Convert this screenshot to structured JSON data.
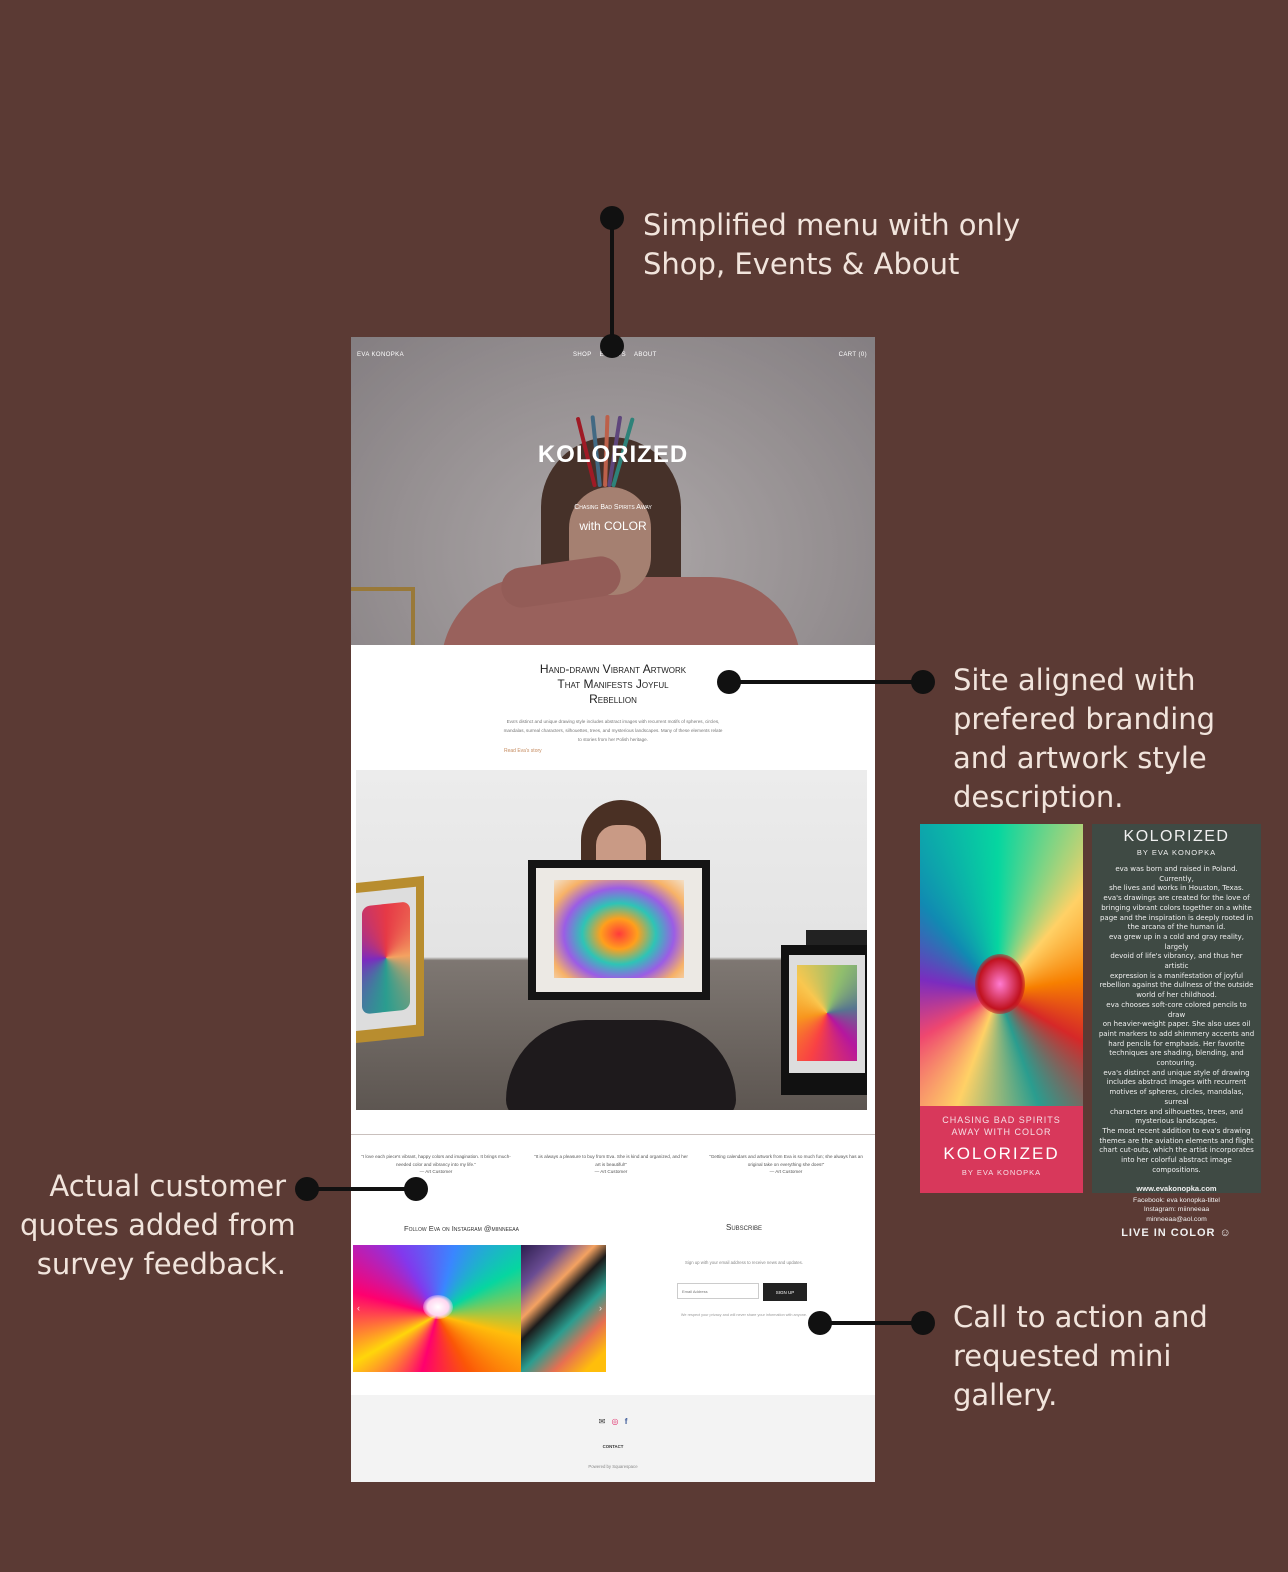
{
  "annotations": {
    "menu": [
      "Simplified menu with only",
      "Shop, Events & About"
    ],
    "branding": [
      "Site aligned with",
      "prefered branding",
      "and artwork style",
      "description."
    ],
    "quotes": [
      "Actual customer",
      "quotes added from",
      "survey feedback."
    ],
    "cta": [
      "Call to action and",
      "requested mini",
      "gallery."
    ]
  },
  "site": {
    "brand": "EVA KONOPKA",
    "menu": [
      "SHOP",
      "EVENTS",
      "ABOUT"
    ],
    "cart": "CART (0)",
    "hero_title": "KOLORIZED",
    "hero_sub1": "Chasing Bad Spirits Away",
    "hero_sub2": "with COLOR",
    "intro_title_1": "Hand-drawn Vibrant Artwork",
    "intro_title_2": "That Manifests Joyful",
    "intro_title_3": "Rebellion",
    "intro_body": "Eva's distinct and unique drawing style includes abstract images with recurrent motifs of spheres, circles, mandalas, surreal characters, silhouettes, trees, and mysterious landscapes. Many of these elements relate to stories from her Polish heritage.",
    "read_more": "Read Eva's story",
    "quotes": [
      {
        "text": "\"I love each piece's vibrant, happy colors and imagination. It brings much-needed color and vibrancy into my life.\"",
        "author": "— Art Customer"
      },
      {
        "text": "\"It is always a pleasure to buy from Eva. She is kind and organized, and her art is beautiful!\"",
        "author": "— Art Customer"
      },
      {
        "text": "\"Getting calendars and artwork from Eva is so much fun; she always has an original take on everything she does!\"",
        "author": "— Art Customer"
      }
    ],
    "follow": "Follow Eva on Instagram @miinneeaa",
    "subscribe_title": "Subscribe",
    "subscribe_desc": "Sign up with your email address to receive news and updates.",
    "email_placeholder": "Email Address",
    "signup_label": "SIGN UP",
    "privacy": "We respect your privacy and will never share your information with anyone.",
    "footer_icons": [
      "mail-icon",
      "instagram-icon",
      "facebook-icon"
    ],
    "contact": "CONTACT",
    "powered": "Powered by Squarespace"
  },
  "brochure": {
    "title": "KOLORIZED",
    "by": "BY EVA KONOPKA",
    "bio": "eva was born and raised in Poland. Currently,\nshe lives and works in Houston, Texas.\neva's drawings are created for the love of\nbringing vibrant colors together on a white\npage and the inspiration is deeply rooted in\nthe arcana of the human id.\neva grew up in a cold and gray reality, largely\ndevoid of life's vibrancy, and thus her artistic\nexpression is a manifestation of joyful\nrebellion against the dullness of the outside\nworld of her childhood.\neva chooses soft-core colored pencils to draw\non heavier-weight paper. She also uses oil\npaint markers to add shimmery accents and\nhard pencils for emphasis. Her favorite\ntechniques are shading, blending, and\ncontouring.\neva's distinct and unique style of drawing\nincludes abstract images with recurrent\nmotives of spheres, circles, mandalas, surreal\ncharacters and silhouettes, trees, and\nmysterious landscapes.\nThe most recent addition to eva's drawing\nthemes are the aviation elements and flight\nchart cut-outs, which the artist incorporates\ninto her colorful abstract image compositions.",
    "website": "www.evakonopka.com",
    "social": "Facebook: eva konopka-tittel\nInstagram: miinneeaa\nminneeaa@aol.com",
    "live": "LIVE IN COLOR ☺",
    "cover_tagline_1": "CHASING BAD SPIRITS",
    "cover_tagline_2": "AWAY WITH COLOR",
    "cover_title": "KOLORIZED",
    "cover_by": "BY EVA KONOPKA"
  },
  "colors": {
    "background": "#5b3a34",
    "annotation_text": "#f1e4dc",
    "accent_link": "#c58a5e",
    "brochure_pink": "#d8385b"
  }
}
